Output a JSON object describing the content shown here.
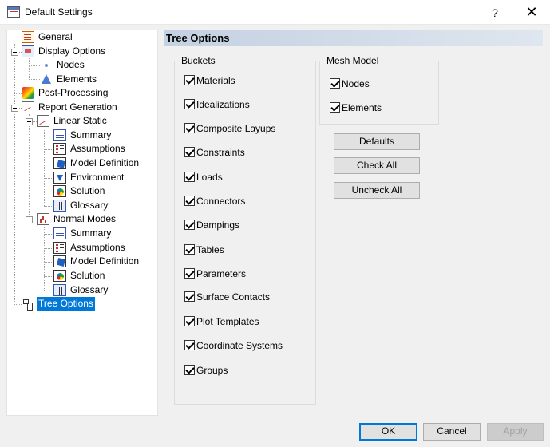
{
  "window": {
    "title": "Default Settings",
    "help_glyph": "?",
    "close_glyph": "✕"
  },
  "tree": [
    {
      "label": "General",
      "icon": "general-icon"
    },
    {
      "label": "Display Options",
      "icon": "display-options-icon"
    },
    {
      "label": "Nodes",
      "icon": "nodes-icon"
    },
    {
      "label": "Elements",
      "icon": "elements-icon"
    },
    {
      "label": "Post-Processing",
      "icon": "post-processing-icon"
    },
    {
      "label": "Report Generation",
      "icon": "report-generation-icon"
    },
    {
      "label": "Linear Static",
      "icon": "linear-static-icon"
    },
    {
      "label": "Summary",
      "icon": "summary-icon"
    },
    {
      "label": "Assumptions",
      "icon": "assumptions-icon"
    },
    {
      "label": "Model Definition",
      "icon": "model-definition-icon"
    },
    {
      "label": "Environment",
      "icon": "environment-icon"
    },
    {
      "label": "Solution",
      "icon": "solution-icon"
    },
    {
      "label": "Glossary",
      "icon": "glossary-icon"
    },
    {
      "label": "Normal Modes",
      "icon": "normal-modes-icon"
    },
    {
      "label": "Summary",
      "icon": "summary-icon"
    },
    {
      "label": "Assumptions",
      "icon": "assumptions-icon"
    },
    {
      "label": "Model Definition",
      "icon": "model-definition-icon"
    },
    {
      "label": "Solution",
      "icon": "solution-icon"
    },
    {
      "label": "Glossary",
      "icon": "glossary-icon"
    },
    {
      "label": "Tree Options",
      "icon": "tree-options-icon",
      "selected": true
    }
  ],
  "panel": {
    "title": "Tree Options",
    "buckets": {
      "label": "Buckets",
      "items": [
        {
          "label": "Materials",
          "checked": true
        },
        {
          "label": "Idealizations",
          "checked": true
        },
        {
          "label": "Composite Layups",
          "checked": true
        },
        {
          "label": "Constraints",
          "checked": true
        },
        {
          "label": "Loads",
          "checked": true
        },
        {
          "label": "Connectors",
          "checked": true
        },
        {
          "label": "Dampings",
          "checked": true
        },
        {
          "label": "Tables",
          "checked": true
        },
        {
          "label": "Parameters",
          "checked": true
        },
        {
          "label": "Surface Contacts",
          "checked": true
        },
        {
          "label": "Plot Templates",
          "checked": true
        },
        {
          "label": "Coordinate Systems",
          "checked": true
        },
        {
          "label": "Groups",
          "checked": true
        }
      ]
    },
    "mesh_model": {
      "label": "Mesh Model",
      "items": [
        {
          "label": "Nodes",
          "checked": true
        },
        {
          "label": "Elements",
          "checked": true
        }
      ]
    },
    "buttons": {
      "defaults": "Defaults",
      "check_all": "Check All",
      "uncheck_all": "Uncheck All"
    }
  },
  "footer": {
    "ok": "OK",
    "cancel": "Cancel",
    "apply": "Apply"
  },
  "colors": {
    "selection": "#0078d7",
    "panel_header": "#c4d1e2"
  }
}
